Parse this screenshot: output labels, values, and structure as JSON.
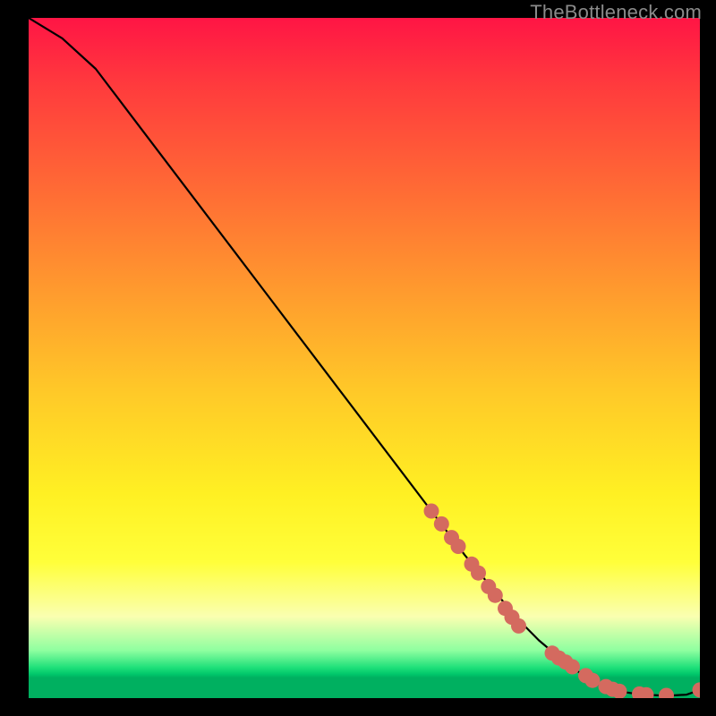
{
  "watermark": "TheBottleneck.com",
  "chart_data": {
    "type": "line",
    "title": "",
    "xlabel": "",
    "ylabel": "",
    "xlim": [
      0,
      100
    ],
    "ylim": [
      0,
      100
    ],
    "series": [
      {
        "name": "curve",
        "x": [
          0,
          5,
          10,
          15,
          20,
          25,
          30,
          35,
          40,
          45,
          50,
          55,
          60,
          65,
          70,
          73,
          76,
          79,
          82,
          84,
          86,
          88,
          90,
          92,
          94,
          96,
          98,
          100
        ],
        "y": [
          100,
          97,
          92.5,
          86,
          79.5,
          73,
          66.5,
          60,
          53.5,
          47,
          40.5,
          34,
          27.5,
          21,
          15,
          11.5,
          8.5,
          6,
          3.8,
          2.4,
          1.6,
          1.0,
          0.7,
          0.5,
          0.4,
          0.4,
          0.5,
          1.2
        ]
      }
    ],
    "markers": {
      "name": "highlighted-points",
      "color": "#d46a5f",
      "x": [
        60,
        61.5,
        63,
        64,
        66,
        67,
        68.5,
        69.5,
        71,
        72,
        73,
        78,
        79,
        80,
        81,
        83,
        84,
        86,
        87,
        88,
        91,
        92,
        95,
        100
      ],
      "y": [
        27.5,
        25.6,
        23.6,
        22.3,
        19.7,
        18.4,
        16.4,
        15.1,
        13.2,
        11.9,
        10.6,
        6.6,
        5.9,
        5.3,
        4.6,
        3.3,
        2.6,
        1.7,
        1.3,
        1.0,
        0.6,
        0.5,
        0.4,
        1.2
      ]
    }
  }
}
